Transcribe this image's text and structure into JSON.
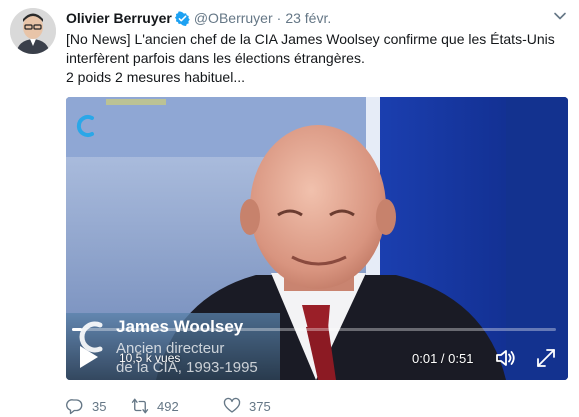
{
  "author": {
    "name": "Olivier Berruyer",
    "handle": "@OBerruyer",
    "separator": "·",
    "date": "23 févr."
  },
  "tweet_text": {
    "line1": "[No News] L'ancien chef de la CIA James Woolsey confirme que les États-Unis",
    "line2": "interfèrent parfois dans les élections étrangères.",
    "line3": "2 poids 2 mesures habituel..."
  },
  "video": {
    "lower_third": {
      "name": "James Woolsey",
      "role_line1": "Ancien directeur",
      "role_line2": "de la CIA, 1993-1995"
    },
    "views": "10,5 k vues",
    "timecode": "0:01 / 0:51",
    "progress": 0.02,
    "icons": [
      "play-icon",
      "volume-icon",
      "fullscreen-icon"
    ]
  },
  "actions": {
    "replies": "35",
    "retweets": "492",
    "likes": "375"
  },
  "colors": {
    "accent": "#1da1f2",
    "muted": "#657786",
    "text": "#14171a",
    "retweet": "#17bf63"
  }
}
